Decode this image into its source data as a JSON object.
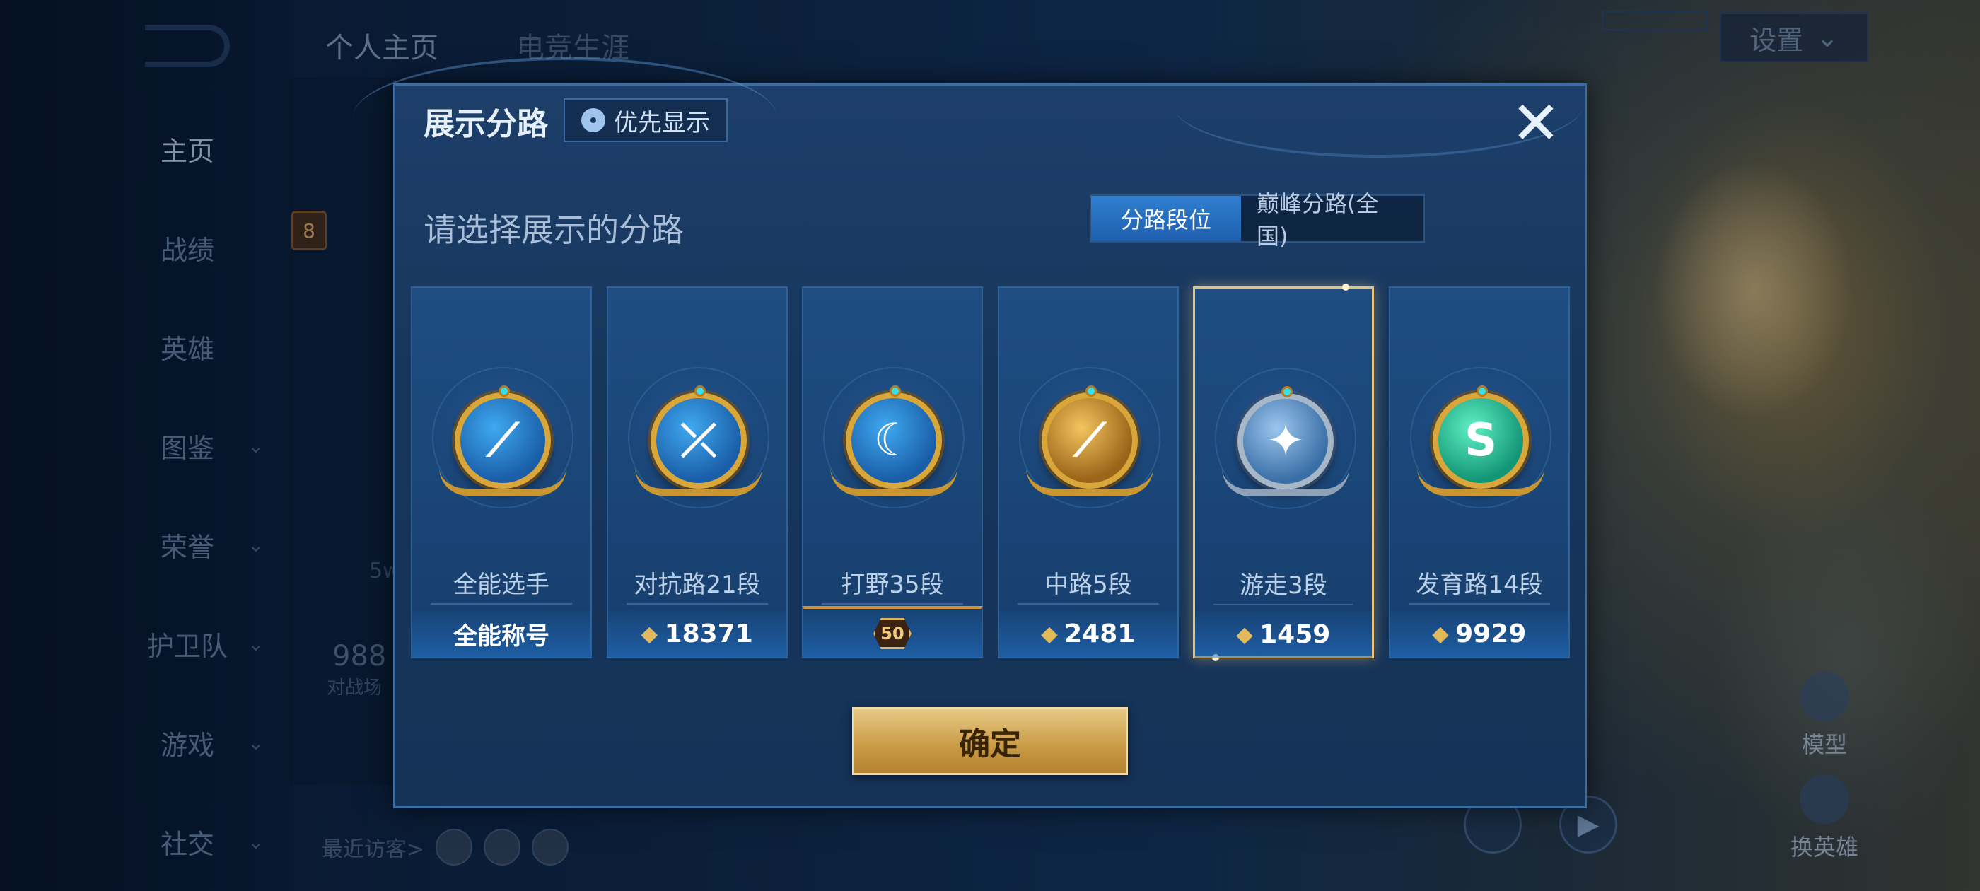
{
  "background": {
    "nav": [
      {
        "label": "主页",
        "chevron": false,
        "active": true
      },
      {
        "label": "战绩",
        "chevron": false
      },
      {
        "label": "英雄",
        "chevron": false
      },
      {
        "label": "图鉴",
        "chevron": true
      },
      {
        "label": "荣誉",
        "chevron": true
      },
      {
        "label": "护卫队",
        "chevron": true
      },
      {
        "label": "游戏",
        "chevron": true
      },
      {
        "label": "社交",
        "chevron": true
      }
    ],
    "top_tabs": [
      "个人主页",
      "电竞生涯"
    ],
    "settings_label": "设置",
    "level_badge": "8",
    "stat_number": "988",
    "stat_label": "对战场",
    "small_text": "5w",
    "recent_visitors_label": "最近访客>",
    "right_buttons": [
      "模型",
      "换英雄"
    ]
  },
  "dialog": {
    "title": "展示分路",
    "preference_button": "优先显示",
    "subtitle": "请选择展示的分路",
    "segment": {
      "options": [
        "分路段位",
        "巅峰分路(全国)"
      ],
      "selected": 0
    },
    "cards": [
      {
        "name": "全能选手",
        "value": "全能称号",
        "value_type": "text",
        "badge": "gold-blue",
        "glyph": "⟋"
      },
      {
        "name": "对抗路21段",
        "value": "18371",
        "value_type": "points",
        "badge": "gold-blue",
        "glyph": "⤫"
      },
      {
        "name": "打野35段",
        "value": "50",
        "value_type": "level",
        "badge": "gold-blue",
        "glyph": "☾"
      },
      {
        "name": "中路5段",
        "value": "2481",
        "value_type": "points",
        "badge": "gold-plain",
        "glyph": "⟋"
      },
      {
        "name": "游走3段",
        "value": "1459",
        "value_type": "points",
        "badge": "silver",
        "glyph": "✦",
        "selected": true
      },
      {
        "name": "发育路14段",
        "value": "9929",
        "value_type": "points",
        "badge": "green",
        "glyph": "S"
      }
    ],
    "points_icon": "⬥",
    "confirm_label": "确定",
    "close_icon": "✕"
  }
}
